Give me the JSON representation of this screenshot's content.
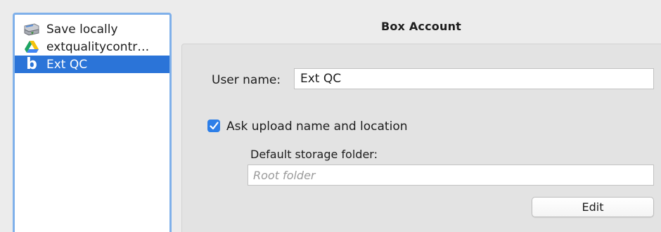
{
  "sidebar": {
    "items": [
      {
        "label": "Save locally",
        "icon": "drive-save-icon",
        "selected": false
      },
      {
        "label": "extqualitycontr…",
        "icon": "google-drive-icon",
        "selected": false
      },
      {
        "label": "Ext QC",
        "icon": "box-logo-icon",
        "selected": true
      }
    ]
  },
  "panel": {
    "title": "Box Account",
    "username_label": "User name:",
    "username_value": "Ext QC",
    "ask_upload_label": "Ask upload name and location",
    "ask_upload_checked": true,
    "default_folder_label": "Default storage folder:",
    "default_folder_placeholder": "Root folder",
    "default_folder_value": "",
    "edit_label": "Edit"
  },
  "colors": {
    "selection": "#2b74d8",
    "focus_ring": "#7fb0ea",
    "checkbox": "#2d7fe8",
    "window_bg": "#ececec",
    "panel_bg": "#e3e3e3"
  }
}
